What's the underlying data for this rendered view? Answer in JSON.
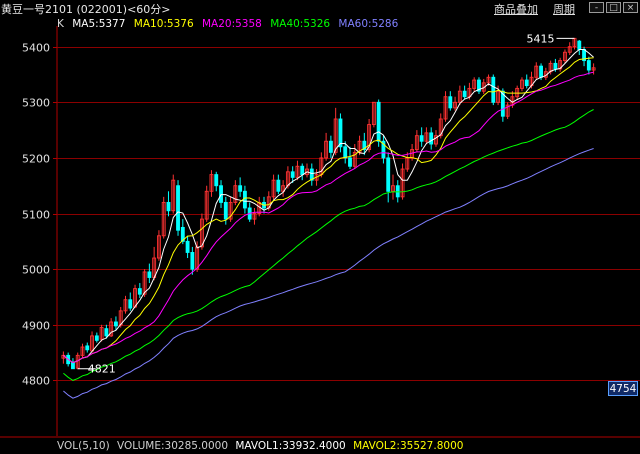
{
  "header": {
    "title": "黄豆一号2101 (022001)<60分>",
    "overlay_label": "商品叠加",
    "period_label": "周期",
    "window_buttons": [
      "-",
      "□",
      "×"
    ]
  },
  "legend": {
    "k_label": "K",
    "items": [
      {
        "label": "MA5:5377",
        "color": "#ffffff"
      },
      {
        "label": "MA10:5376",
        "color": "#ffff00"
      },
      {
        "label": "MA20:5358",
        "color": "#ff00ff"
      },
      {
        "label": "MA40:5326",
        "color": "#00ff00"
      },
      {
        "label": "MA60:5286",
        "color": "#8080ff"
      }
    ]
  },
  "volume": {
    "items": [
      {
        "label": "VOL(5,10)",
        "color": "#cfcfcf"
      },
      {
        "label": "VOLUME:30285.0000",
        "color": "#cfcfcf"
      },
      {
        "label": "MAVOL1:33932.4000",
        "color": "#ffffff"
      },
      {
        "label": "MAVOL2:35527.8000",
        "color": "#ffff00"
      }
    ]
  },
  "current_price": "4754",
  "chart_data": {
    "type": "candlestick",
    "ylim": [
      4700,
      5430
    ],
    "y_ticks": [
      4800,
      4900,
      5000,
      5100,
      5200,
      5300,
      5400
    ],
    "high_marker": {
      "label": "5415",
      "value": 5415
    },
    "low_marker": {
      "label": "4821",
      "value": 4821
    },
    "colors": {
      "up": "#ff3232",
      "down": "#00ffff",
      "grid": "#8b0000",
      "axis": "#b00000"
    },
    "candles": [
      [
        4840,
        4845,
        4830,
        4852
      ],
      [
        4845,
        4830,
        4825,
        4850
      ],
      [
        4832,
        4821,
        4821,
        4840
      ],
      [
        4822,
        4845,
        4820,
        4850
      ],
      [
        4845,
        4860,
        4840,
        4866
      ],
      [
        4862,
        4855,
        4850,
        4868
      ],
      [
        4853,
        4880,
        4850,
        4888
      ],
      [
        4880,
        4872,
        4868,
        4886
      ],
      [
        4874,
        4895,
        4870,
        4900
      ],
      [
        4893,
        4880,
        4875,
        4900
      ],
      [
        4880,
        4905,
        4878,
        4912
      ],
      [
        4905,
        4898,
        4890,
        4915
      ],
      [
        4900,
        4925,
        4895,
        4932
      ],
      [
        4925,
        4945,
        4920,
        4952
      ],
      [
        4945,
        4930,
        4925,
        4958
      ],
      [
        4932,
        4965,
        4930,
        4972
      ],
      [
        4965,
        4955,
        4948,
        4975
      ],
      [
        4955,
        4995,
        4950,
        5000
      ],
      [
        4995,
        4985,
        4975,
        5010
      ],
      [
        4985,
        5020,
        4980,
        5040
      ],
      [
        5020,
        5060,
        5015,
        5070
      ],
      [
        5060,
        5120,
        5055,
        5130
      ],
      [
        5120,
        5105,
        5095,
        5140
      ],
      [
        5105,
        5160,
        5100,
        5170
      ],
      [
        5150,
        5070,
        5060,
        5160
      ],
      [
        5075,
        5050,
        5045,
        5090
      ],
      [
        5050,
        5030,
        5020,
        5060
      ],
      [
        5030,
        5000,
        4990,
        5040
      ],
      [
        5000,
        5040,
        4995,
        5050
      ],
      [
        5040,
        5090,
        5035,
        5100
      ],
      [
        5090,
        5140,
        5085,
        5150
      ],
      [
        5140,
        5170,
        5130,
        5178
      ],
      [
        5170,
        5150,
        5140,
        5175
      ],
      [
        5150,
        5120,
        5110,
        5160
      ],
      [
        5120,
        5090,
        5080,
        5130
      ],
      [
        5090,
        5120,
        5085,
        5130
      ],
      [
        5120,
        5150,
        5115,
        5160
      ],
      [
        5150,
        5140,
        5130,
        5165
      ],
      [
        5140,
        5110,
        5100,
        5150
      ],
      [
        5110,
        5090,
        5085,
        5120
      ],
      [
        5090,
        5100,
        5080,
        5110
      ],
      [
        5100,
        5120,
        5095,
        5130
      ],
      [
        5120,
        5110,
        5100,
        5130
      ],
      [
        5110,
        5130,
        5105,
        5140
      ],
      [
        5130,
        5160,
        5125,
        5170
      ],
      [
        5160,
        5140,
        5135,
        5170
      ],
      [
        5140,
        5150,
        5130,
        5160
      ],
      [
        5150,
        5175,
        5145,
        5185
      ],
      [
        5175,
        5165,
        5155,
        5185
      ],
      [
        5165,
        5185,
        5160,
        5195
      ],
      [
        5185,
        5170,
        5160,
        5190
      ],
      [
        5170,
        5180,
        5165,
        5190
      ],
      [
        5180,
        5160,
        5150,
        5190
      ],
      [
        5160,
        5170,
        5150,
        5180
      ],
      [
        5170,
        5200,
        5165,
        5210
      ],
      [
        5200,
        5230,
        5195,
        5245
      ],
      [
        5230,
        5210,
        5200,
        5240
      ],
      [
        5210,
        5270,
        5205,
        5290
      ],
      [
        5270,
        5220,
        5210,
        5280
      ],
      [
        5220,
        5200,
        5190,
        5230
      ],
      [
        5200,
        5185,
        5180,
        5220
      ],
      [
        5185,
        5210,
        5180,
        5225
      ],
      [
        5210,
        5230,
        5205,
        5240
      ],
      [
        5230,
        5215,
        5205,
        5245
      ],
      [
        5215,
        5260,
        5210,
        5270
      ],
      [
        5260,
        5300,
        5255,
        5300
      ],
      [
        5300,
        5230,
        5220,
        5305
      ],
      [
        5230,
        5200,
        5190,
        5240
      ],
      [
        5200,
        5140,
        5120,
        5210
      ],
      [
        5140,
        5150,
        5125,
        5170
      ],
      [
        5150,
        5130,
        5120,
        5160
      ],
      [
        5130,
        5180,
        5125,
        5190
      ],
      [
        5180,
        5200,
        5175,
        5210
      ],
      [
        5200,
        5215,
        5195,
        5225
      ],
      [
        5215,
        5240,
        5210,
        5250
      ],
      [
        5240,
        5230,
        5220,
        5255
      ],
      [
        5230,
        5245,
        5225,
        5255
      ],
      [
        5245,
        5225,
        5215,
        5255
      ],
      [
        5225,
        5240,
        5220,
        5250
      ],
      [
        5240,
        5270,
        5235,
        5280
      ],
      [
        5270,
        5310,
        5265,
        5320
      ],
      [
        5310,
        5290,
        5285,
        5320
      ],
      [
        5290,
        5300,
        5285,
        5310
      ],
      [
        5300,
        5320,
        5295,
        5330
      ],
      [
        5320,
        5310,
        5305,
        5330
      ],
      [
        5310,
        5325,
        5305,
        5335
      ],
      [
        5325,
        5340,
        5320,
        5345
      ],
      [
        5340,
        5320,
        5315,
        5345
      ],
      [
        5320,
        5335,
        5315,
        5342
      ],
      [
        5335,
        5345,
        5330,
        5350
      ],
      [
        5345,
        5300,
        5295,
        5350
      ],
      [
        5300,
        5320,
        5295,
        5330
      ],
      [
        5320,
        5275,
        5265,
        5325
      ],
      [
        5275,
        5295,
        5270,
        5300
      ],
      [
        5295,
        5310,
        5290,
        5320
      ],
      [
        5310,
        5325,
        5305,
        5330
      ],
      [
        5325,
        5340,
        5320,
        5345
      ],
      [
        5340,
        5330,
        5325,
        5350
      ],
      [
        5330,
        5345,
        5325,
        5355
      ],
      [
        5345,
        5365,
        5340,
        5372
      ],
      [
        5365,
        5345,
        5340,
        5370
      ],
      [
        5345,
        5355,
        5340,
        5362
      ],
      [
        5355,
        5370,
        5350,
        5375
      ],
      [
        5370,
        5360,
        5355,
        5378
      ],
      [
        5360,
        5375,
        5355,
        5380
      ],
      [
        5375,
        5390,
        5370,
        5395
      ],
      [
        5390,
        5400,
        5385,
        5408
      ],
      [
        5400,
        5415,
        5395,
        5415
      ],
      [
        5410,
        5395,
        5385,
        5412
      ],
      [
        5395,
        5375,
        5365,
        5400
      ],
      [
        5375,
        5358,
        5350,
        5382
      ],
      [
        5358,
        5362,
        5350,
        5370
      ]
    ]
  }
}
